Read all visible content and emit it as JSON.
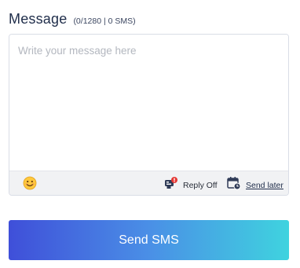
{
  "message": {
    "title": "Message",
    "counter": "(0/1280 | 0 SMS)",
    "placeholder": "Write your message here",
    "value": ""
  },
  "toolbar": {
    "emoji_icon": "smiley-emoji-icon",
    "reply_icon": "reply-toggle-icon",
    "reply_label": "Reply Off",
    "schedule_icon": "calendar-clock-icon",
    "send_later_label": "Send later"
  },
  "send_button": {
    "label": "Send SMS"
  },
  "colors": {
    "gradient_start": "#3f4fd9",
    "gradient_end": "#3fd3df",
    "title": "#1f2d4a",
    "toolbar_bg": "#f1f2f4",
    "reply_badge": "#e53935"
  }
}
